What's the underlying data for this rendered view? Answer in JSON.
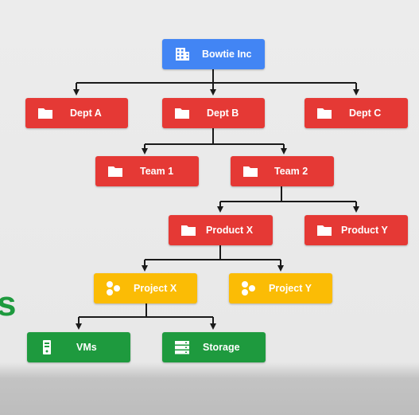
{
  "colors": {
    "org": "#4285f4",
    "folder": "#e53935",
    "project": "#fbbc05",
    "resource": "#1e9a3e",
    "line": "#1a1a1a"
  },
  "side_text": "s",
  "nodes": {
    "bowtie": {
      "label": "Bowtie Inc",
      "icon": "building-icon"
    },
    "dept_a": {
      "label": "Dept A",
      "icon": "folder-icon"
    },
    "dept_b": {
      "label": "Dept B",
      "icon": "folder-icon"
    },
    "dept_c": {
      "label": "Dept C",
      "icon": "folder-icon"
    },
    "team_1": {
      "label": "Team 1",
      "icon": "folder-icon"
    },
    "team_2": {
      "label": "Team 2",
      "icon": "folder-icon"
    },
    "product_x": {
      "label": "Product X",
      "icon": "folder-icon"
    },
    "product_y": {
      "label": "Product Y",
      "icon": "folder-icon"
    },
    "project_x": {
      "label": "Project X",
      "icon": "project-icon"
    },
    "project_y": {
      "label": "Project Y",
      "icon": "project-icon"
    },
    "vms": {
      "label": "VMs",
      "icon": "server-icon"
    },
    "storage": {
      "label": "Storage",
      "icon": "storage-icon"
    }
  }
}
